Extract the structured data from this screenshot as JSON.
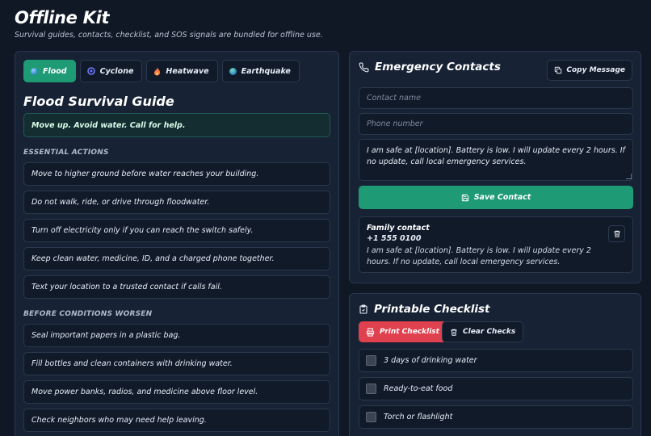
{
  "app": {
    "title": "Offline Kit",
    "subtitle": "Survival guides, contacts, checklist, and SOS signals are bundled for offline use."
  },
  "colors": {
    "accent": "#1e9a74",
    "danger": "#e0414e",
    "background": "#101826",
    "panel": "#172234"
  },
  "tabs": [
    {
      "label": "Flood",
      "icon": "water-globe-icon",
      "active": true
    },
    {
      "label": "Cyclone",
      "icon": "cyclone-icon",
      "active": false
    },
    {
      "label": "Heatwave",
      "icon": "flame-icon",
      "active": false
    },
    {
      "label": "Earthquake",
      "icon": "globe-icon",
      "active": false
    }
  ],
  "guide": {
    "title": "Flood Survival Guide",
    "alert": "Move up. Avoid water. Call for help.",
    "sections": [
      {
        "label": "ESSENTIAL ACTIONS",
        "items": [
          "Move to higher ground before water reaches your building.",
          "Do not walk, ride, or drive through floodwater.",
          "Turn off electricity only if you can reach the switch safely.",
          "Keep clean water, medicine, ID, and a charged phone together.",
          "Text your location to a trusted contact if calls fail."
        ]
      },
      {
        "label": "BEFORE CONDITIONS WORSEN",
        "items": [
          "Seal important papers in a plastic bag.",
          "Fill bottles and clean containers with drinking water.",
          "Move power banks, radios, and medicine above floor level.",
          "Check neighbors who may need help leaving."
        ]
      }
    ]
  },
  "contacts": {
    "title": "Emergency Contacts",
    "copy_label": "Copy Message",
    "name_placeholder": "Contact name",
    "phone_placeholder": "Phone number",
    "message_value": "I am safe at [location]. Battery is low. I will update every 2 hours. If no update, call local emergency services.",
    "save_label": "Save Contact",
    "saved": [
      {
        "name": "Family contact",
        "phone": "+1 555 0100",
        "message": "I am safe at [location]. Battery is low. I will update every 2 hours. If no update, call local emergency services."
      }
    ]
  },
  "checklist": {
    "title": "Printable Checklist",
    "print_label": "Print Checklist",
    "clear_label": "Clear Checks",
    "items": [
      {
        "label": "3 days of drinking water",
        "checked": false
      },
      {
        "label": "Ready-to-eat food",
        "checked": false
      },
      {
        "label": "Torch or flashlight",
        "checked": false
      }
    ]
  }
}
